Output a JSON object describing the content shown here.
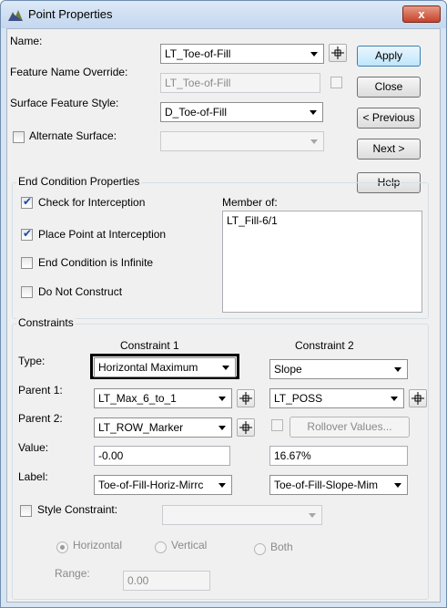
{
  "window": {
    "title": "Point Properties",
    "close_glyph": "x"
  },
  "top": {
    "name_label": "Name:",
    "name_value": "LT_Toe-of-Fill",
    "feature_name_override_label": "Feature Name Override:",
    "feature_name_override_value": "LT_Toe-of-Fill",
    "surface_feature_style_label": "Surface Feature Style:",
    "surface_feature_style_value": "D_Toe-of-Fill",
    "alternate_surface_label": "Alternate Surface:",
    "alternate_surface_value": ""
  },
  "buttons": {
    "apply": "Apply",
    "close": "Close",
    "previous": "< Previous",
    "next": "Next >",
    "help": "Help"
  },
  "end_condition": {
    "group_title": "End Condition Properties",
    "check_interception_label": "Check for Interception",
    "check_interception_checked": true,
    "place_point_label": "Place Point at Interception",
    "place_point_checked": true,
    "infinite_label": "End Condition is Infinite",
    "infinite_checked": false,
    "do_not_construct_label": "Do Not Construct",
    "do_not_construct_checked": false,
    "member_of_label": "Member of:",
    "member_of_items": [
      "LT_Fill-6/1"
    ]
  },
  "constraints": {
    "group_title": "Constraints",
    "constraint1_header": "Constraint 1",
    "constraint2_header": "Constraint 2",
    "type_label": "Type:",
    "parent1_label": "Parent 1:",
    "parent2_label": "Parent 2:",
    "value_label": "Value:",
    "label_label": "Label:",
    "c1": {
      "type": "Horizontal Maximum",
      "parent1": "LT_Max_6_to_1",
      "parent2": "LT_ROW_Marker",
      "value": "-0.00",
      "label": "Toe-of-Fill-Horiz-Mirrc"
    },
    "c2": {
      "type": "Slope",
      "parent1": "LT_POSS",
      "rollover_label": "Rollover Values...",
      "value": "16.67%",
      "label": "Toe-of-Fill-Slope-Mim"
    },
    "style_constraint_label": "Style Constraint:",
    "style_constraint_value": "",
    "radio_horizontal": "Horizontal",
    "radio_vertical": "Vertical",
    "radio_both": "Both",
    "range_label": "Range:",
    "range_value": "0.00"
  },
  "colors": {
    "title_gradient": "#c4d7ee",
    "close_red": "#c5432b",
    "highlight_border": "#000000"
  }
}
